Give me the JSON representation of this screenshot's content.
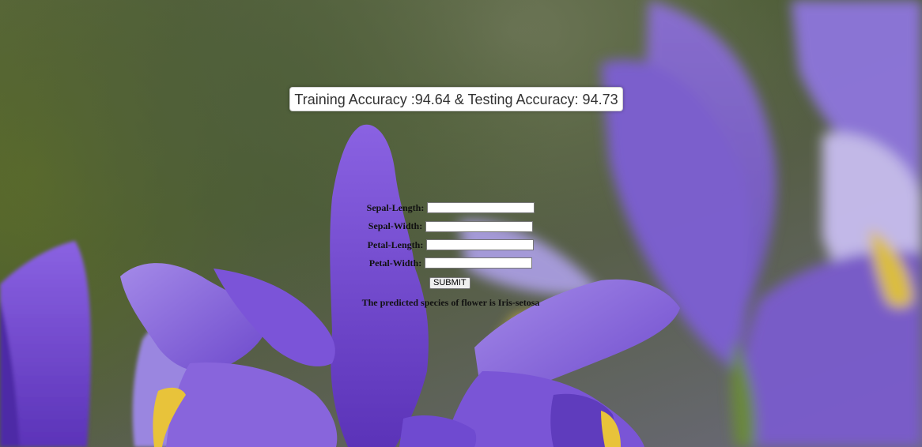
{
  "background": {
    "image_name": "iris-flower-background-image"
  },
  "header": {
    "accuracy_text": "Training Accuracy :94.64 & Testing Accuracy: 94.73"
  },
  "form": {
    "fields": [
      {
        "label": "Sepal-Length:",
        "value": ""
      },
      {
        "label": "Sepal-Width:",
        "value": ""
      },
      {
        "label": "Petal-Length:",
        "value": ""
      },
      {
        "label": "Petal-Width:",
        "value": ""
      }
    ],
    "submit_label": "SUBMIT"
  },
  "result": {
    "text": "The predicted species of flower is Iris-setosa"
  },
  "colors": {
    "petal_purple": "#7a4fd8",
    "petal_light": "#9b7ae6",
    "stamen_yellow": "#e7c23a",
    "foliage_green": "#4f5f3a"
  }
}
